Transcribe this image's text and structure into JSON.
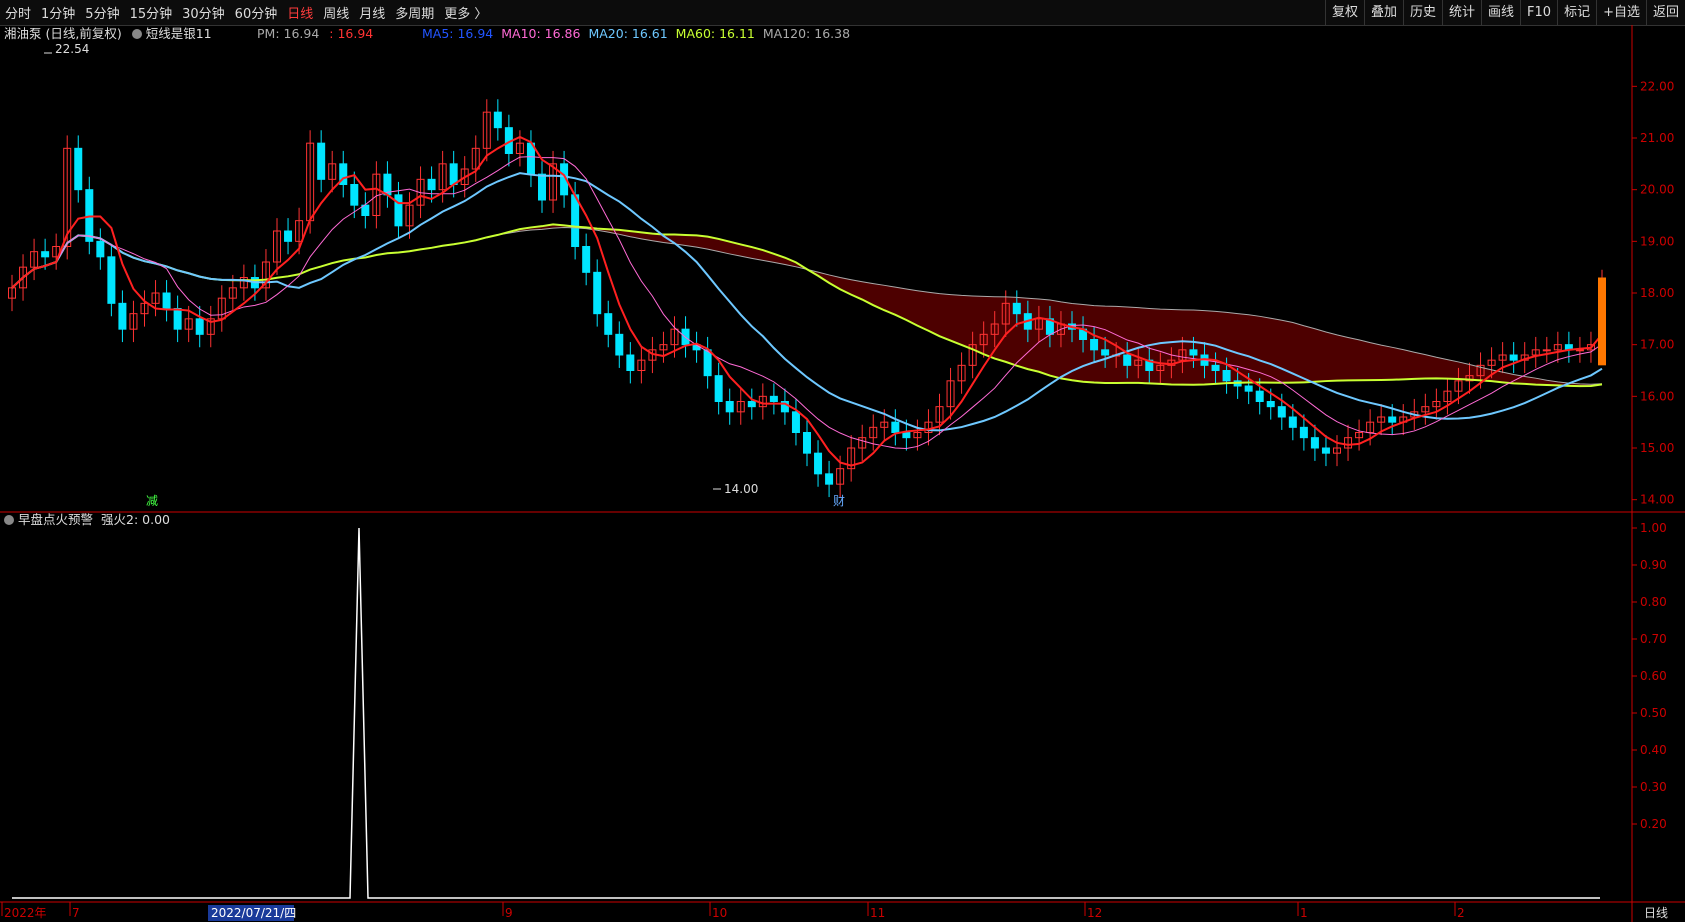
{
  "toolbar": {
    "periods": [
      "分时",
      "1分钟",
      "5分钟",
      "15分钟",
      "30分钟",
      "60分钟",
      "日线",
      "周线",
      "月线",
      "多周期",
      "更多 〉"
    ],
    "active_period": "日线",
    "right_buttons": [
      "复权",
      "叠加",
      "历史",
      "统计",
      "画线",
      "F10",
      "标记",
      "+自选",
      "返回"
    ]
  },
  "main_info": {
    "stock": "湘油泵 (日线,前复权)",
    "indicator": "短线是银11",
    "pm_label": "PM: 16.94",
    "pm_value": ": 16.94",
    "ma5": "MA5: 16.94",
    "ma10": "MA10: 16.86",
    "ma20": "MA20: 16.61",
    "ma60": "MA60: 16.11",
    "ma120": "MA120: 16.38"
  },
  "sub_info": {
    "indicator": "早盘点火预警",
    "value": "强火2: 0.00"
  },
  "colors": {
    "up": "#ff3333",
    "down": "#00e5ff",
    "ma5": "#ff2020",
    "ma10": "#ff6ad5",
    "ma20": "#6ec8ff",
    "ma60": "#c8ff32",
    "ma120": "#aaaaaa",
    "axis": "#cc0000"
  },
  "chart_data": {
    "type": "candlestick",
    "y_axis": [
      "22.00",
      "21.00",
      "20.00",
      "19.00",
      "18.00",
      "17.00",
      "16.00",
      "15.00",
      "14.00"
    ],
    "y_range": [
      13.8,
      22.8
    ],
    "high_label": "22.54",
    "low_label": "14.00",
    "markers": {
      "jian": "减",
      "cai": "财"
    },
    "sub_y_axis": [
      "1.00",
      "0.90",
      "0.80",
      "0.70",
      "0.60",
      "0.50",
      "0.40",
      "0.30",
      "0.20"
    ],
    "sub_range": [
      0,
      1.0
    ],
    "x_labels": [
      "2022年",
      "7",
      "9",
      "10",
      "11",
      "12",
      "1",
      "2"
    ],
    "cursor_date": "2022/07/21/四",
    "period_label": "日线",
    "closes": [
      18.1,
      18.5,
      18.8,
      18.7,
      18.9,
      20.8,
      20.0,
      19.0,
      18.7,
      17.8,
      17.3,
      17.6,
      17.8,
      18.0,
      17.7,
      17.3,
      17.5,
      17.2,
      17.5,
      17.9,
      18.1,
      18.3,
      18.1,
      18.6,
      19.2,
      19.0,
      19.4,
      20.9,
      20.2,
      20.5,
      20.1,
      19.7,
      19.5,
      20.3,
      19.9,
      19.3,
      19.7,
      20.2,
      20.0,
      20.5,
      20.1,
      20.4,
      20.8,
      21.5,
      21.2,
      20.7,
      20.9,
      20.3,
      19.8,
      20.5,
      19.9,
      18.9,
      18.4,
      17.6,
      17.2,
      16.8,
      16.5,
      16.7,
      16.9,
      17.0,
      17.3,
      17.0,
      16.9,
      16.4,
      15.9,
      15.7,
      15.9,
      15.8,
      16.0,
      15.9,
      15.7,
      15.3,
      14.9,
      14.5,
      14.3,
      14.6,
      15.0,
      15.2,
      15.4,
      15.5,
      15.3,
      15.2,
      15.3,
      15.5,
      15.8,
      16.3,
      16.6,
      17.0,
      17.2,
      17.4,
      17.8,
      17.6,
      17.3,
      17.5,
      17.2,
      17.4,
      17.3,
      17.1,
      16.9,
      16.8,
      16.8,
      16.6,
      16.7,
      16.5,
      16.6,
      16.7,
      16.9,
      16.8,
      16.6,
      16.5,
      16.3,
      16.2,
      16.1,
      15.9,
      15.8,
      15.6,
      15.4,
      15.2,
      15.0,
      14.9,
      15.0,
      15.2,
      15.3,
      15.5,
      15.6,
      15.5,
      15.6,
      15.7,
      15.8,
      15.9,
      16.1,
      16.3,
      16.4,
      16.6,
      16.7,
      16.8,
      16.7,
      16.8,
      16.9,
      16.9,
      17.0,
      16.9,
      16.9,
      17.0,
      18.2
    ]
  }
}
